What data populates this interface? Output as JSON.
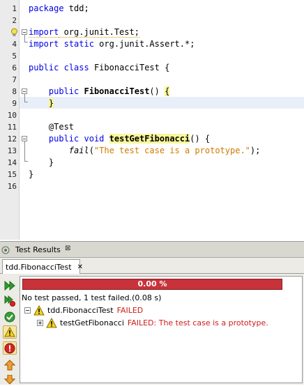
{
  "editor": {
    "line_numbers": [
      "1",
      "2",
      "3",
      "4",
      "5",
      "6",
      "7",
      "8",
      "9",
      "10",
      "11",
      "12",
      "13",
      "14",
      "15",
      "16"
    ],
    "lines": {
      "l1_kw": "package",
      "l1_rest": " tdd;",
      "l3_kw": "import",
      "l3_rest": " org.junit.Test;",
      "l4_kw1": "import",
      "l4_kw2": "static",
      "l4_rest": " org.junit.Assert.*;",
      "l6_kw1": "public",
      "l6_kw2": "class",
      "l6_rest": " FibonacciTest {",
      "l8_kw": "public",
      "l8_name": "FibonacciTest",
      "l8_rest": "() ",
      "l8_brace": "{",
      "l9_brace": "}",
      "l11_ann": "@Test",
      "l12_kw1": "public",
      "l12_kw2": "void",
      "l12_name": "testGetFibonacci",
      "l12_rest": "() {",
      "l13_call": "fail",
      "l13_open": "(",
      "l13_str": "\"The test case is a prototype.\"",
      "l13_close": ");",
      "l14": "}",
      "l15": "}"
    }
  },
  "panel": {
    "title": "Test Results",
    "close_glyph": "⊠",
    "tab_label": "tdd.FibonacciTest",
    "tab_close": "✕",
    "progress_label": "0.00 %",
    "progress_fraction": 0.0,
    "summary": "No test passed, 1 test failed.(0.08 s)",
    "tree": {
      "suite_name": "tdd.FibonacciTest",
      "suite_status": "FAILED",
      "test_name": "testGetFibonacci",
      "test_status": "FAILED: The test case is a prototype."
    }
  },
  "colors": {
    "progress_fail": "#c8323a",
    "failed_text": "#d11a1a",
    "keyword": "#0000e6",
    "string": "#ce7b00"
  }
}
